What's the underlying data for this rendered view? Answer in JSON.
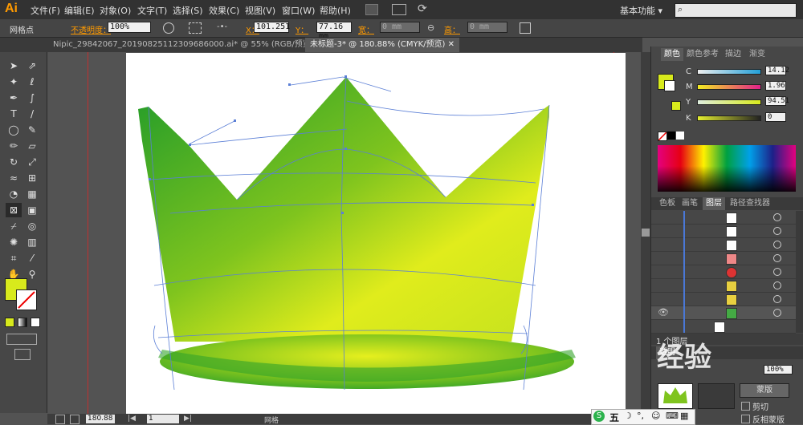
{
  "app": {
    "logo": "Ai",
    "workspace": "基本功能 ▾"
  },
  "menu": [
    "文件(F)",
    "编辑(E)",
    "对象(O)",
    "文字(T)",
    "选择(S)",
    "效果(C)",
    "视图(V)",
    "窗口(W)",
    "帮助(H)"
  ],
  "control": {
    "tool_name": "网格点",
    "opacity_label": "不透明度：",
    "opacity_value": "100%",
    "x_label": "X：",
    "x_value": "101.251",
    "y_label": "Y：",
    "y_value": "77.16 mm",
    "w_label": "宽：",
    "w_value": "0 mm",
    "h_label": "高：",
    "h_value": "0 mm"
  },
  "tabs": [
    {
      "label": "Nipic_29842067_20190825112309686000.ai* @ 55% (RGB/预览)"
    },
    {
      "label": "未标题-3* @ 180.88% (CMYK/预览)"
    }
  ],
  "color_panel": {
    "tabs": [
      "颜色",
      "颜色参考",
      "描边",
      "渐变"
    ],
    "channels": [
      {
        "name": "C",
        "value": "14.12",
        "color": "#22a0d8"
      },
      {
        "name": "M",
        "value": "1.96",
        "color": "#e0208a"
      },
      {
        "name": "Y",
        "value": "94.51",
        "color": "#f2e400"
      },
      {
        "name": "K",
        "value": "0",
        "color": "#111111"
      }
    ],
    "fill_color": "#d8ea1c"
  },
  "layers_panel": {
    "tabs": [
      "色板",
      "画笔",
      "图层",
      "路径查找器"
    ],
    "footer": "1 个图层"
  },
  "transparency_panel": {
    "tab": "透明",
    "opacity": "100%",
    "mask_button": "蒙版",
    "clip": "剪切",
    "invert": "反相蒙版"
  },
  "status": {
    "zoom": "180.88",
    "page": "1",
    "tool": "网格"
  },
  "watermark": "经验",
  "ime": "五"
}
